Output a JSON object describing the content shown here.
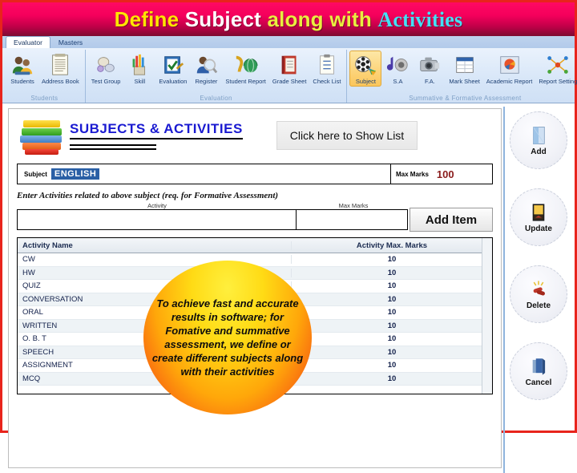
{
  "banner": {
    "part1": "Define ",
    "part2": "Subject ",
    "part3": "along with ",
    "part4": "Activities"
  },
  "colors": {
    "banner_pink": "#f5005c",
    "banner_dark": "#7d0b31",
    "title_yellow": "#ffe500",
    "title_white": "#ffffff",
    "title_cyan": "#44e0f5",
    "heading_blue": "#1a1ad1",
    "selection_blue": "#2a5fa5",
    "marks_red": "#8a1c1c",
    "frame_red": "#e8241c",
    "ribbon_selected": "#fbc65b"
  },
  "ribbon": {
    "tabs": [
      {
        "label": "Evaluator",
        "active": true
      },
      {
        "label": "Masters",
        "active": false
      }
    ],
    "groups": [
      {
        "label": "Students",
        "items": [
          {
            "label": "Students",
            "icon": "students-icon",
            "selected": false
          },
          {
            "label": "Address Book",
            "icon": "address-book-icon",
            "selected": false
          }
        ]
      },
      {
        "label": "Evaluation",
        "items": [
          {
            "label": "Test Group",
            "icon": "test-group-icon",
            "selected": false
          },
          {
            "label": "Skill",
            "icon": "skill-icon",
            "selected": false
          },
          {
            "label": "Evaluation",
            "icon": "evaluation-icon",
            "selected": false
          },
          {
            "label": "Register",
            "icon": "register-icon",
            "selected": false
          },
          {
            "label": "Student Report",
            "icon": "student-report-icon",
            "selected": false
          },
          {
            "label": "Grade Sheet",
            "icon": "grade-sheet-icon",
            "selected": false
          },
          {
            "label": "Check List",
            "icon": "check-list-icon",
            "selected": false
          }
        ]
      },
      {
        "label": "Summative & Formative Assessment",
        "items": [
          {
            "label": "Subject",
            "icon": "subject-icon",
            "selected": true
          },
          {
            "label": "S.A",
            "icon": "sa-icon",
            "selected": false
          },
          {
            "label": "F.A.",
            "icon": "fa-icon",
            "selected": false
          },
          {
            "label": "Mark Sheet",
            "icon": "mark-sheet-icon",
            "selected": false
          },
          {
            "label": "Academic Report",
            "icon": "academic-report-icon",
            "selected": false
          },
          {
            "label": "Report Setting",
            "icon": "report-setting-icon",
            "selected": false
          }
        ]
      }
    ]
  },
  "form": {
    "heading": "SUBJECTS & ACTIVITIES",
    "show_list_button": "Click here to Show List",
    "subject_label": "Subject",
    "subject_value": "ENGLISH",
    "max_marks_label": "Max Marks",
    "max_marks_value": "100",
    "instruction": "Enter Activities related to above subject (req. for Formative Assessment)",
    "activity_col_label": "Activity",
    "max_marks_col_label": "Max Marks",
    "activity_input_value": "",
    "activity_input_placeholder": "",
    "marks_input_value": "",
    "marks_input_placeholder": "",
    "add_item_button": "Add Item",
    "add_item_accel": "I"
  },
  "table": {
    "headers": [
      "Activity Name",
      "Activity Max. Marks"
    ],
    "rows": [
      {
        "name": "CW",
        "marks": "10"
      },
      {
        "name": "HW",
        "marks": "10"
      },
      {
        "name": "QUIZ",
        "marks": "10"
      },
      {
        "name": "CONVERSATION",
        "marks": "10"
      },
      {
        "name": "ORAL",
        "marks": "10"
      },
      {
        "name": "WRITTEN",
        "marks": "10"
      },
      {
        "name": "O. B. T",
        "marks": "10"
      },
      {
        "name": "SPEECH",
        "marks": "10"
      },
      {
        "name": "ASSIGNMENT",
        "marks": "10"
      },
      {
        "name": "MCQ",
        "marks": "10"
      }
    ]
  },
  "callout": {
    "text": "To achieve fast and accurate results in software; for Fomative and summative assessment, we define or create different subjects along with their activities"
  },
  "sidebar": {
    "buttons": [
      {
        "label": "Add",
        "icon": "add-icon"
      },
      {
        "label": "Update",
        "icon": "update-icon"
      },
      {
        "label": "Delete",
        "icon": "delete-icon"
      },
      {
        "label": "Cancel",
        "icon": "cancel-icon"
      }
    ]
  }
}
